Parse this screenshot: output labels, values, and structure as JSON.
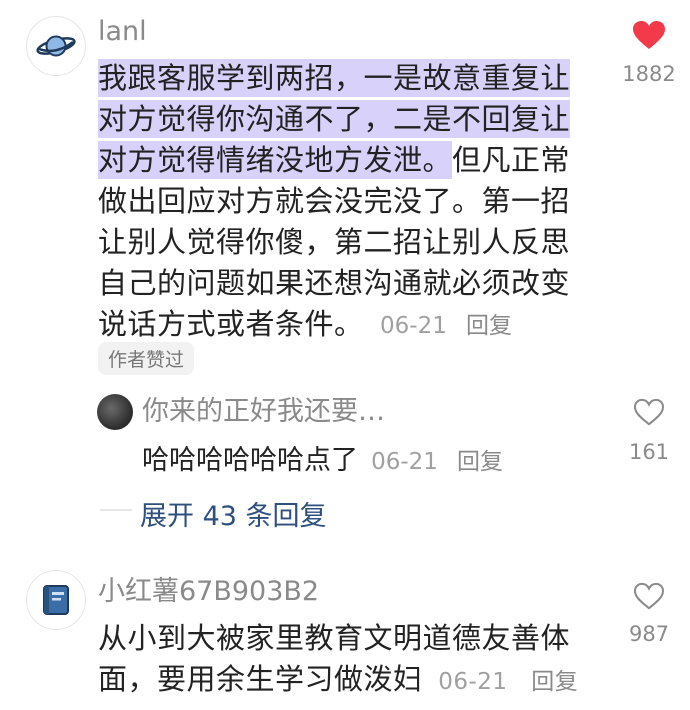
{
  "comments": [
    {
      "username": "lanl",
      "text_highlight": "我跟客服学到两招，一是故意重复让对方觉得你沟通不了，二是不回复让对方觉得情绪没地方发泄。",
      "text_rest": "但凡正常做出回应对方就会没完没了。第一招让别人觉得你傻，第二招让别人反思自己的问题如果还想沟通就必须改变说话方式或者条件。",
      "date": "06-21",
      "reply_label": "回复",
      "likes": "1882",
      "liked": true,
      "badge": "作者赞过"
    },
    {
      "username": "小红薯67B903B2",
      "text": "从小到大被家里教育文明道德友善体面，要用余生学习做泼妇",
      "date": "06-21",
      "reply_label": "回复",
      "likes": "987",
      "liked": false
    }
  ],
  "sub_reply": {
    "username": "你来的正好我还要…",
    "text": "哈哈哈哈哈哈点了",
    "date": "06-21",
    "reply_label": "回复",
    "likes": "161"
  },
  "expand_replies": "展开 43 条回复",
  "colors": {
    "highlight": "#d8d2fb",
    "heart": "#f23a4a",
    "link": "#2f4f7f"
  }
}
